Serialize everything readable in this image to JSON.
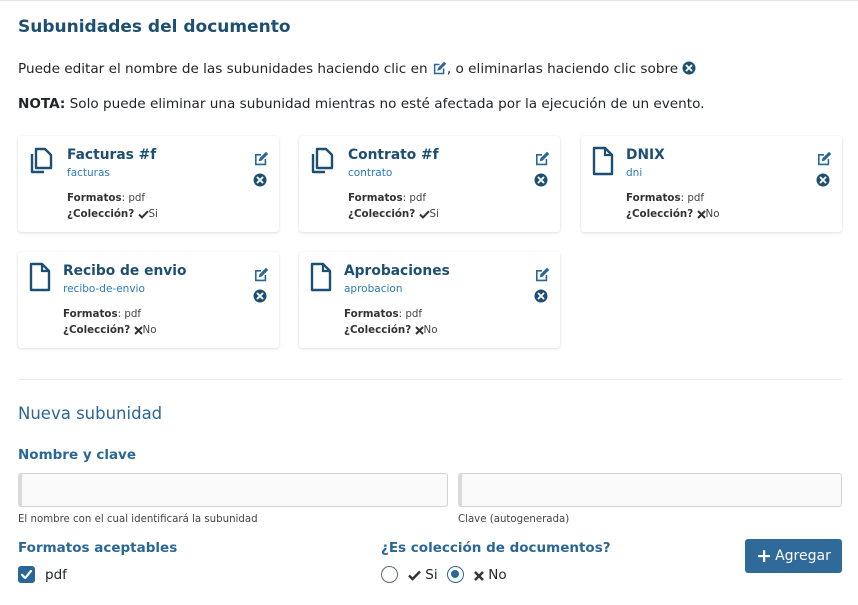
{
  "page": {
    "title": "Subunidades del documento",
    "help_part1": "Puede editar el nombre de las subunidades haciendo clic en ",
    "help_part2": ", o eliminarlas haciendo clic sobre ",
    "note_label": "NOTA:",
    "note_text": " Solo puede eliminar una subunidad mientras no esté afectada por la ejecución de un evento."
  },
  "labels": {
    "formats": "Formatos",
    "collection": "¿Colección?"
  },
  "subunits": [
    {
      "name": "Facturas #f",
      "key": "facturas",
      "formats": "pdf",
      "collection": "Si",
      "icon": "copy-icon"
    },
    {
      "name": "Contrato #f",
      "key": "contrato",
      "formats": "pdf",
      "collection": "Si",
      "icon": "copy-icon"
    },
    {
      "name": "DNIX",
      "key": "dni",
      "formats": "pdf",
      "collection": "No",
      "icon": "file-icon"
    },
    {
      "name": "Recibo de envio",
      "key": "recibo-de-envio",
      "formats": "pdf",
      "collection": "No",
      "icon": "file-icon"
    },
    {
      "name": "Aprobaciones",
      "key": "aprobacion",
      "formats": "pdf",
      "collection": "No",
      "icon": "file-icon"
    }
  ],
  "form": {
    "heading": "Nueva subunidad",
    "name_key_label": "Nombre y clave",
    "name_value": "",
    "key_value": "",
    "name_hint": "El nombre con el cual identificará la subunidad",
    "key_hint": "Clave (autogenerada)",
    "formats_label": "Formatos aceptables",
    "format_option": "pdf",
    "format_checked": true,
    "collection_label": "¿Es colección de documentos?",
    "option_yes": "Si",
    "option_no": "No",
    "selected": "No",
    "add_button": "Agregar"
  },
  "colors": {
    "primary": "#2a6796",
    "heading": "#1d4f73",
    "key_link": "#2a7ab8"
  }
}
